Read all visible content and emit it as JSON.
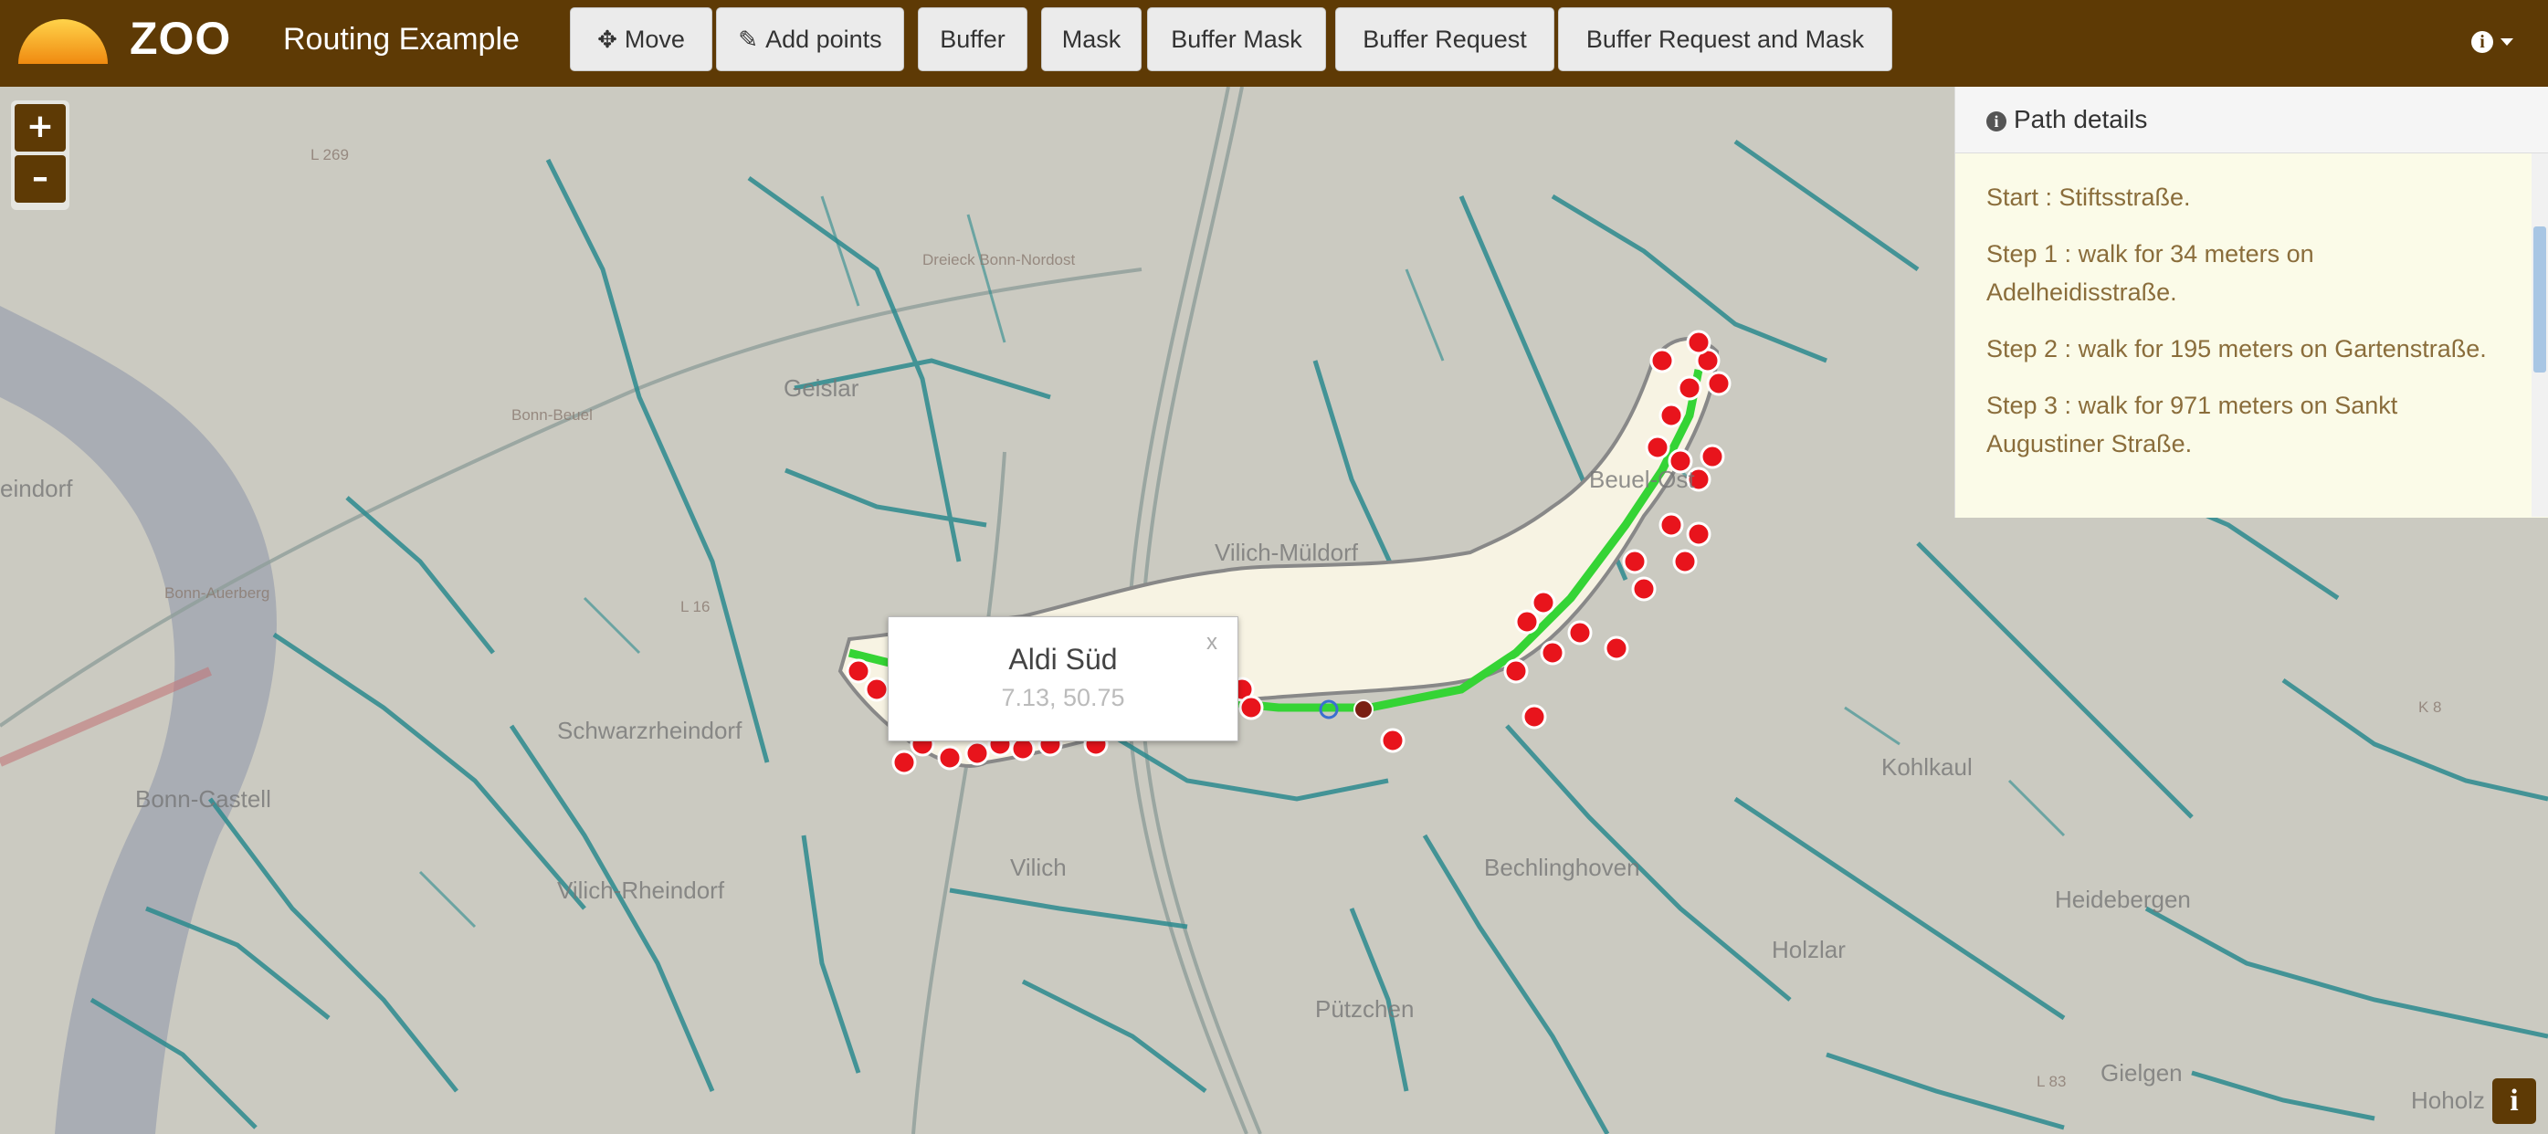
{
  "header": {
    "brand": "ZOO",
    "app_title": "Routing Example",
    "buttons": [
      {
        "label": "Move",
        "icon": "move-icon"
      },
      {
        "label": "Add points",
        "icon": "pencil-icon"
      },
      {
        "label": "Buffer"
      },
      {
        "label": "Mask"
      },
      {
        "label": "Buffer Mask"
      },
      {
        "label": "Buffer Request"
      },
      {
        "label": "Buffer Request and Mask"
      }
    ],
    "info_menu_icon": "info-circle-icon"
  },
  "map": {
    "zoom_in_label": "+",
    "zoom_out_label": "–",
    "labels": [
      "Geislar",
      "Vilich-Müldorf",
      "Schwarzrheindorf",
      "Bonn-Castell",
      "Vilich-Rheindorf",
      "Beuel-Ost",
      "Vilich",
      "Bechlinghoven",
      "Pützchen",
      "Holzlar",
      "Heidebergen",
      "Kohlkaul",
      "Gielgen",
      "Hoholz",
      "eindorf",
      "Dreieck Bonn-Nordost",
      "Bonn-Beuel",
      "Bonn-Auerberg",
      "L 269",
      "L 16",
      "K 8",
      "L 83"
    ],
    "popup": {
      "title": "Aldi Süd",
      "coords": "7.13, 50.75",
      "close": "x"
    },
    "attribution_label": "i"
  },
  "path_details": {
    "title": "Path details",
    "steps": [
      "Start : Stiftsstraße.",
      "Step 1 : walk for 34 meters on Adelheidisstraße.",
      "Step 2 : walk for 195 meters on Gartenstraße.",
      "Step 3 : walk for 971 meters on Sankt Augustiner Straße."
    ]
  },
  "colors": {
    "header": "#5e3a05",
    "route": "#35d435",
    "roads": "#2c8a8e",
    "poi": "#e8141c"
  }
}
